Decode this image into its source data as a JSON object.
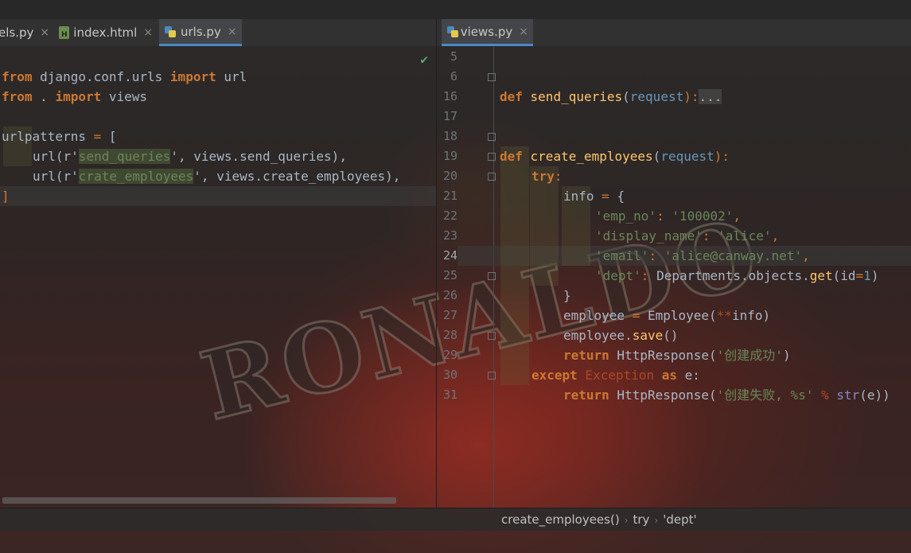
{
  "colors": {
    "keyword": "#cc7832",
    "string": "#6a8759",
    "function": "#ffc66d",
    "number": "#6897bb",
    "parameter": "#aa4926",
    "text": "#a9b7c6",
    "tab_accent": "#4a88c7",
    "check": "#59a869"
  },
  "left_pane": {
    "tabs": [
      {
        "label": "els.py",
        "icon": "python-file-icon",
        "close": "×"
      },
      {
        "label": "index.html",
        "icon": "html-file-icon",
        "close": "×"
      },
      {
        "label": "urls.py",
        "icon": "python-file-icon",
        "close": "×",
        "active": true
      }
    ],
    "check_icon": "✔",
    "lines": {
      "l1": {
        "a": "from",
        "b": " django.conf.urls ",
        "c": "import",
        "d": " url"
      },
      "l2": {
        "a": "from",
        "b": " . ",
        "c": "import",
        "d": " views"
      },
      "l4": {
        "a": "urlpatterns ",
        "b": "=",
        "c": " ["
      },
      "l5": {
        "a": "url(r'",
        "b": "send_queries",
        "c": "', views.send_queries),"
      },
      "l6": {
        "a": "url(r'",
        "b": "crate_employees",
        "c": "', views.create_employees),"
      },
      "l7": {
        "a": "]"
      }
    }
  },
  "right_pane": {
    "tabs": [
      {
        "label": "views.py",
        "icon": "python-file-icon",
        "close": "×",
        "active": true
      }
    ],
    "line_numbers": [
      "5",
      "6",
      "16",
      "17",
      "18",
      "19",
      "20",
      "21",
      "22",
      "23",
      "24",
      "25",
      "26",
      "27",
      "28",
      "29",
      "30",
      "31"
    ],
    "lines": {
      "l6": {
        "kw": "def",
        "fn": " send_queries",
        "p1": "(",
        "param": "request",
        "p2": "):",
        "fold": "..."
      },
      "l18": {
        "kw": "def",
        "fn": " create_employees",
        "p1": "(",
        "param": "request",
        "p2": "):"
      },
      "l19": {
        "kw": "try",
        "p": ":"
      },
      "l20": {
        "a": "info ",
        "op": "=",
        "b": " {"
      },
      "l21": {
        "k": "'emp_no'",
        "c": ": ",
        "v": "'100002'",
        "e": ","
      },
      "l22": {
        "k": "'display_name'",
        "c": ": ",
        "v": "'alice'",
        "e": ","
      },
      "l23": {
        "k": "'email'",
        "c": ": ",
        "v": "'alice@canway.net'",
        "e": ","
      },
      "l24": {
        "k": "'dept'",
        "c": ": ",
        "a": "Departments.objects.",
        "fn": "get",
        "b": "(id",
        "op": "=",
        "num": "1",
        "e": ")"
      },
      "l25": {
        "a": "}"
      },
      "l26": {
        "a": "employee ",
        "op": "=",
        "b": " Employee(",
        "op2": "**",
        "c": "info)"
      },
      "l27": {
        "a": "employee.",
        "fn": "save",
        "b": "()"
      },
      "l28": {
        "kw": "return",
        "a": " HttpResponse(",
        "s": "'创建成功'",
        "b": ")"
      },
      "l29": {
        "kw": "except",
        "a": " Exception ",
        "kw2": "as",
        "b": " e:"
      },
      "l30": {
        "kw": "return",
        "a": " HttpResponse(",
        "s": "'创建失败, %s'",
        "op": " %",
        "bi": " str",
        "b": "(e))"
      }
    }
  },
  "breadcrumb": {
    "items": [
      "create_employees()",
      "try",
      "'dept'"
    ],
    "sep": "›"
  },
  "wallpaper_text": "RONALDO"
}
